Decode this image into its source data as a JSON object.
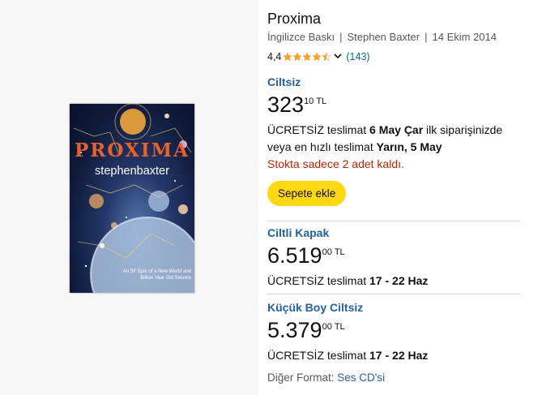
{
  "product": {
    "title": "Proxima",
    "edition": "İngilizce Baskı",
    "author": "Stephen Baxter",
    "date": "14 Ekim 2014",
    "rating_value": "4,4",
    "rating_stars": 4.4,
    "review_count": "(143)"
  },
  "cover": {
    "title": "PROXIMA",
    "author": "stephenbaxter",
    "tagline_1": "An SF Epic of a New World and",
    "tagline_2": "Billion Year Old Secrets"
  },
  "formats": [
    {
      "name": "Ciltsiz",
      "price_whole": "323",
      "price_fraction": "10",
      "currency": "TL",
      "delivery_prefix": "ÜCRETSİZ teslimat ",
      "delivery_date": "6 May Çar",
      "delivery_suffix": " ilk siparişinizde",
      "fast_prefix": "veya en hızlı teslimat ",
      "fast_date": "Yarın, 5 May",
      "stock": "Stokta sadece 2 adet kaldı.",
      "button": "Sepete ekle"
    },
    {
      "name": "Ciltli Kapak",
      "price_whole": "6.519",
      "price_fraction": "00",
      "currency": "TL",
      "delivery_prefix": "ÜCRETSİZ teslimat ",
      "delivery_date": "17 - 22 Haz"
    },
    {
      "name": "Küçük Boy Ciltsiz",
      "price_whole": "5.379",
      "price_fraction": "00",
      "currency": "TL",
      "delivery_prefix": "ÜCRETSİZ teslimat ",
      "delivery_date": "17 - 22 Haz"
    }
  ],
  "other_format": {
    "label": "Diğer Format: ",
    "link": "Ses CD'si"
  },
  "colors": {
    "link": "#2162a1",
    "star": "#ffa41c",
    "button": "#ffd814",
    "stock": "#b12704"
  }
}
